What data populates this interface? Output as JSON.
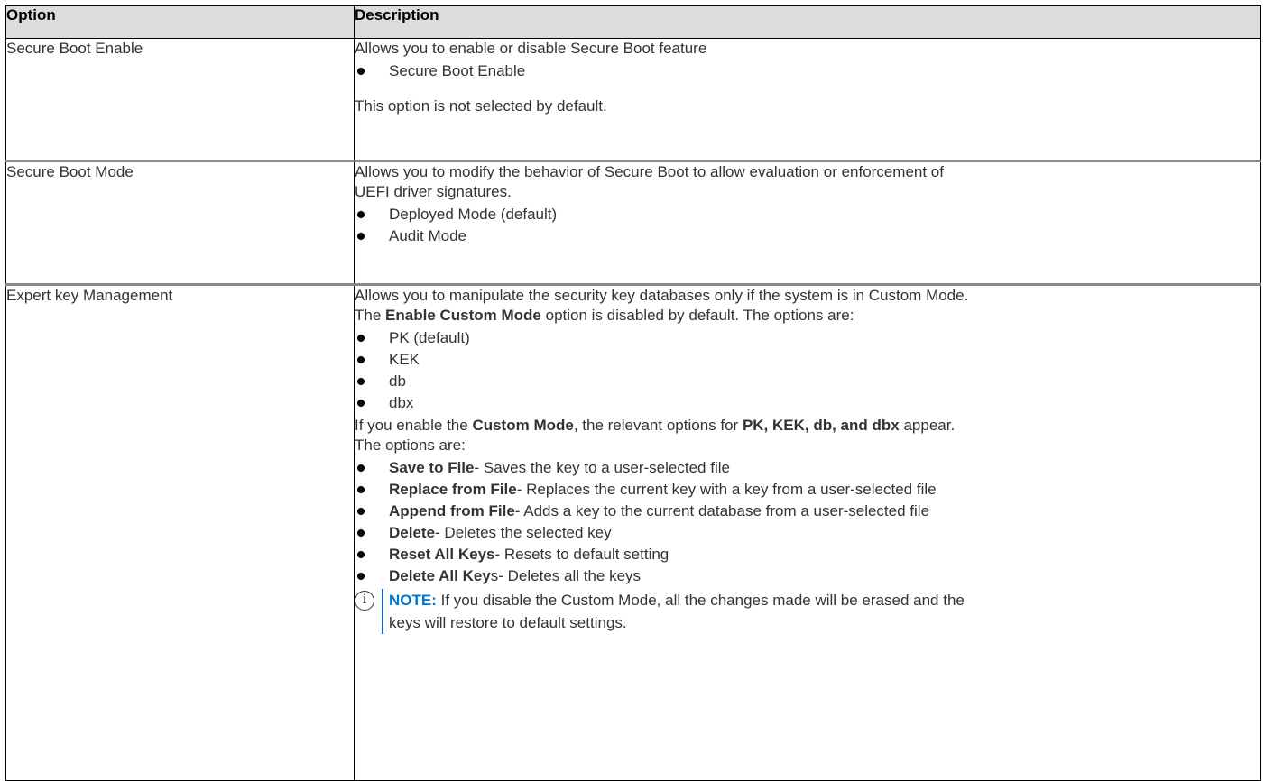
{
  "table": {
    "headers": {
      "option": "Option",
      "description": "Description"
    },
    "rows": [
      {
        "option": "Secure Boot Enable",
        "intro": "Allows you to enable or disable Secure Boot feature",
        "items": [
          "Secure Boot Enable"
        ],
        "after": "This option is not selected by default."
      },
      {
        "option": "Secure Boot Mode",
        "intro_line1": "Allows you to modify the behavior of Secure Boot to allow evaluation or enforcement of",
        "intro_line2": "UEFI driver signatures.",
        "items": [
          "Deployed Mode (default)",
          "Audit Mode"
        ]
      },
      {
        "option": "Expert key Management",
        "intro_line1": "Allows you to manipulate the security key databases only if the system is in Custom Mode.",
        "intro2_pre": "The ",
        "intro2_bold": "Enable Custom Mode",
        "intro2_post": " option is disabled by default. The options are:",
        "items": [
          "PK (default)",
          "KEK",
          "db",
          "dbx"
        ],
        "custom_pre": "If you enable the ",
        "custom_bold1": "Custom Mode",
        "custom_mid": ", the relevant options for ",
        "custom_bold2": "PK, KEK, db, and dbx",
        "custom_post": " appear.",
        "custom_line2": "The options are:",
        "options": [
          {
            "bold": "Save to File",
            "text": "- Saves the key to a user-selected file"
          },
          {
            "bold": "Replace from File",
            "text": "- Replaces the current key with a key from a user-selected file"
          },
          {
            "bold": "Append from File",
            "text": "- Adds a key to the current database from a user-selected file"
          },
          {
            "bold": "Delete",
            "text": "- Deletes the selected key"
          },
          {
            "bold": "Reset All Keys",
            "text": "- Resets to default setting"
          },
          {
            "bold": "Delete All Key",
            "text": "s- Deletes all the keys"
          }
        ],
        "note": {
          "icon": "info-circle-icon",
          "label": "NOTE:",
          "line1": " If you disable the Custom Mode, all the changes made will be erased and the",
          "line2": "keys will restore to default settings."
        }
      }
    ]
  },
  "colors": {
    "header_bg": "#dcdcdc",
    "note_label": "#0076ce",
    "note_bar": "#0a66c2"
  }
}
